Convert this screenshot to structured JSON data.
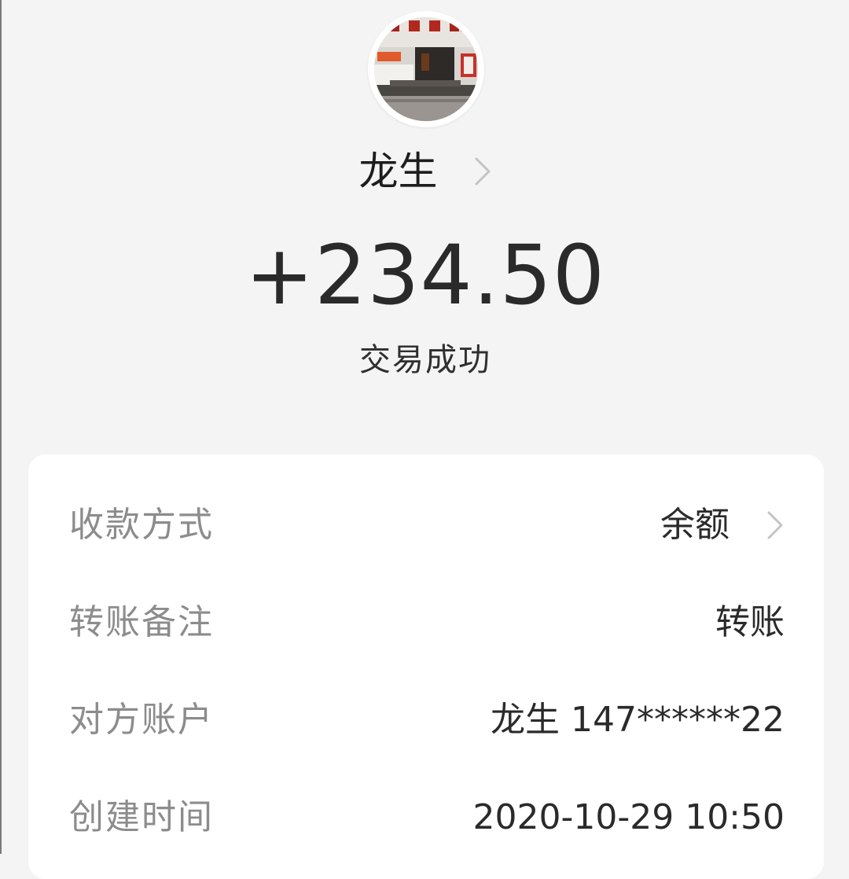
{
  "header": {
    "avatar_alt": "龙生",
    "name": "龙生",
    "amount": "+234.50",
    "status": "交易成功"
  },
  "details": {
    "rows": [
      {
        "label": "收款方式",
        "value": "余额"
      },
      {
        "label": "转账备注",
        "value": "转账"
      },
      {
        "label": "对方账户",
        "value": "龙生 147******22"
      },
      {
        "label": "创建时间",
        "value": "2020-10-29 10:50"
      }
    ]
  },
  "icons": {
    "name_chevron": "chevron-right-icon",
    "payment_chevron": "chevron-right-icon"
  },
  "colors": {
    "background": "#f4f4f4",
    "card": "#ffffff",
    "label": "#8c8c8c",
    "value": "#2a2a2a",
    "chevron": "#c4c4c4"
  }
}
